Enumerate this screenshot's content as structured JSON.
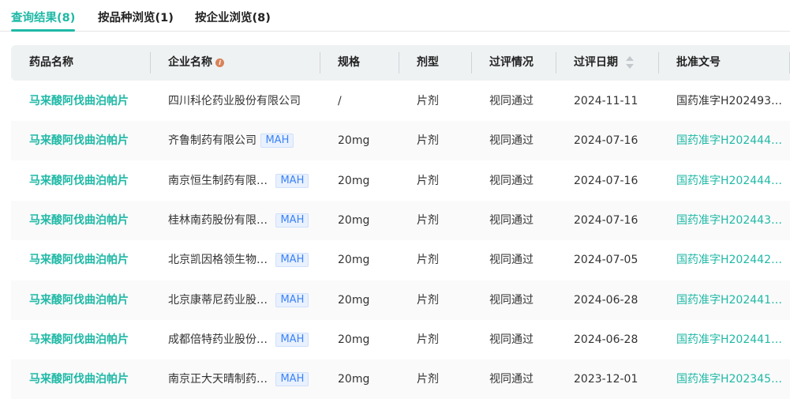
{
  "tabs": [
    {
      "label": "查询结果(8)",
      "active": true
    },
    {
      "label": "按品种浏览(1)"
    },
    {
      "label": "按企业浏览(8)"
    }
  ],
  "columns": [
    "药品名称",
    "企业名称",
    "规格",
    "剂型",
    "过评情况",
    "过评日期",
    "批准文号"
  ],
  "info_icon": "i",
  "rows": [
    {
      "drug": "马来酸阿伐曲泊帕片",
      "company": "四川科伦药业股份有限公司",
      "mah": "",
      "spec": "/",
      "form": "片剂",
      "status": "视同通过",
      "date": "2024-11-11",
      "approval": "国药准字H202493…",
      "approval_link": false
    },
    {
      "drug": "马来酸阿伐曲泊帕片",
      "company": "齐鲁制药有限公司",
      "mah": "MAH",
      "spec": "20mg",
      "form": "片剂",
      "status": "视同通过",
      "date": "2024-07-16",
      "approval": "国药准字H202444…",
      "approval_link": true
    },
    {
      "drug": "马来酸阿伐曲泊帕片",
      "company": "南京恒生制药有限…",
      "mah": "MAH",
      "spec": "20mg",
      "form": "片剂",
      "status": "视同通过",
      "date": "2024-07-16",
      "approval": "国药准字H202444…",
      "approval_link": true
    },
    {
      "drug": "马来酸阿伐曲泊帕片",
      "company": "桂林南药股份有限…",
      "mah": "MAH",
      "spec": "20mg",
      "form": "片剂",
      "status": "视同通过",
      "date": "2024-07-16",
      "approval": "国药准字H202443…",
      "approval_link": true
    },
    {
      "drug": "马来酸阿伐曲泊帕片",
      "company": "北京凯因格领生物…",
      "mah": "MAH",
      "spec": "20mg",
      "form": "片剂",
      "status": "视同通过",
      "date": "2024-07-05",
      "approval": "国药准字H202442…",
      "approval_link": true
    },
    {
      "drug": "马来酸阿伐曲泊帕片",
      "company": "北京康蒂尼药业股…",
      "mah": "MAH",
      "spec": "20mg",
      "form": "片剂",
      "status": "视同通过",
      "date": "2024-06-28",
      "approval": "国药准字H202441…",
      "approval_link": true
    },
    {
      "drug": "马来酸阿伐曲泊帕片",
      "company": "成都倍特药业股份…",
      "mah": "MAH",
      "spec": "20mg",
      "form": "片剂",
      "status": "视同通过",
      "date": "2024-06-28",
      "approval": "国药准字H202441…",
      "approval_link": true
    },
    {
      "drug": "马来酸阿伐曲泊帕片",
      "company": "南京正大天晴制药…",
      "mah": "MAH",
      "spec": "20mg",
      "form": "片剂",
      "status": "视同通过",
      "date": "2023-12-01",
      "approval": "国药准字H202345…",
      "approval_link": true
    }
  ]
}
